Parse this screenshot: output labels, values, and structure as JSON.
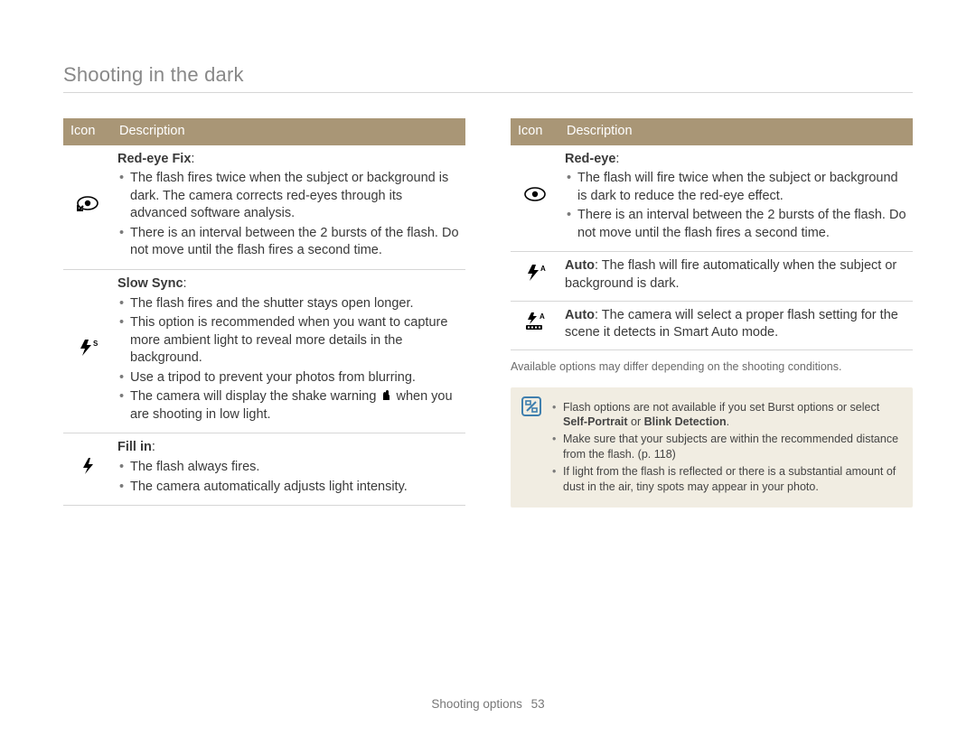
{
  "page_title": "Shooting in the dark",
  "footer": {
    "section": "Shooting options",
    "page": "53"
  },
  "headers": {
    "icon": "Icon",
    "description": "Description"
  },
  "left": [
    {
      "icon": "red-eye-fix-icon",
      "title": "Red-eye Fix",
      "bullets": [
        "The flash fires twice when the subject or background is dark. The camera corrects red-eyes through its advanced software analysis.",
        "There is an interval between the 2 bursts of the flash. Do not move until the flash fires a second time."
      ]
    },
    {
      "icon": "slow-sync-icon",
      "title": "Slow Sync",
      "bullets": [
        "The flash fires and the shutter stays open longer.",
        "This option is recommended when you want to capture more ambient light to reveal more details in the background.",
        "Use a tripod to prevent your photos from blurring.",
        {
          "pre": "The camera will display the shake warning ",
          "iconName": "shake-warning-icon",
          "post": " when you are shooting in low light."
        }
      ]
    },
    {
      "icon": "fill-in-icon",
      "title": "Fill in",
      "bullets": [
        "The flash always fires.",
        "The camera automatically adjusts light intensity."
      ]
    }
  ],
  "right": [
    {
      "icon": "red-eye-icon",
      "title": "Red-eye",
      "bullets": [
        "The flash will fire twice when the subject or background is dark to reduce the red-eye effect.",
        "There is an interval between the 2 bursts of the flash. Do not move until the flash fires a second time."
      ]
    },
    {
      "icon": "flash-auto-icon",
      "inline_label": "Auto",
      "inline_text": ": The flash will fire automatically when the subject or background is dark."
    },
    {
      "icon": "smart-auto-icon",
      "inline_label": "Auto",
      "inline_text": ": The camera will select a proper flash setting for the scene it detects in Smart Auto mode."
    }
  ],
  "availability_note": "Available options may differ depending on the shooting conditions.",
  "notes": [
    {
      "pre": "Flash options are not available if you set Burst options or select ",
      "bold1": "Self-Portrait",
      "mid": " or ",
      "bold2": "Blink Detection",
      "post": "."
    },
    "Make sure that your subjects are within the recommended distance from the flash. (p. 118)",
    "If light from the flash is reflected or there is a substantial amount of dust in the air, tiny spots may appear in your photo."
  ]
}
